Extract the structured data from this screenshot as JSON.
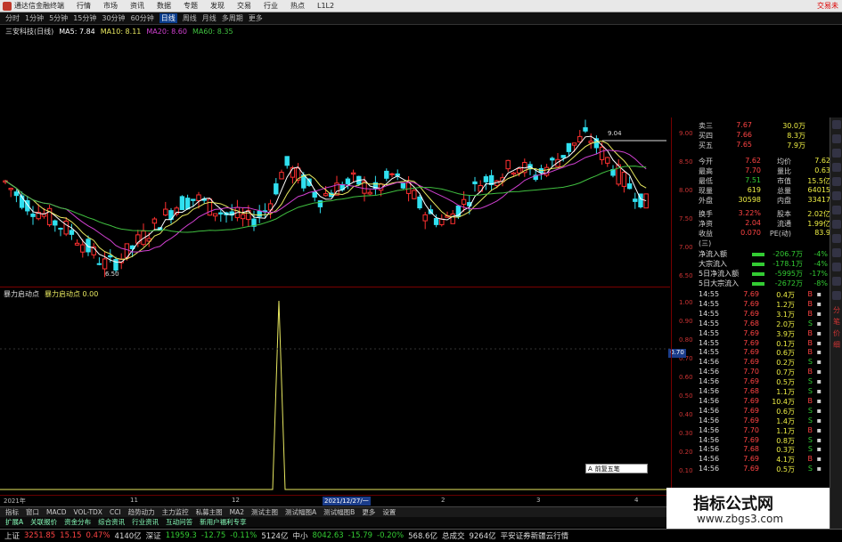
{
  "menubar": {
    "app_title": "通达信金融终端",
    "items": [
      "行情",
      "市场",
      "资讯",
      "数据",
      "专题",
      "发现",
      "交易",
      "行业",
      "热点",
      "L1L2"
    ],
    "right_label": "交易未"
  },
  "periodbar": {
    "items": [
      "分时",
      "1分钟",
      "5分钟",
      "15分钟",
      "30分钟",
      "60分钟",
      "日线",
      "周线",
      "月线",
      "多周期",
      "更多"
    ],
    "active": "日线"
  },
  "ma_legend": {
    "stock": "三安科技(日线)",
    "ma5": "MA5: 7.84",
    "ma10": "MA10: 8.11",
    "ma20": "MA20: 8.60",
    "ma60": "MA60: 8.35"
  },
  "kline": {
    "price_labels": [
      "9.00",
      "8.50",
      "8.00",
      "7.50",
      "7.00",
      "6.50"
    ],
    "low_mark": "6.50",
    "high_mark": "9.04",
    "colors": {
      "up": "#ff3030",
      "down": "#30e0f0",
      "ma5": "#ffffff",
      "ma10": "#e8e860",
      "ma20": "#d040d0",
      "ma60": "#40c040"
    }
  },
  "indicator": {
    "name": "暴力启动点",
    "legend": "暴力启动点 0.00",
    "y_labels": [
      "1.00",
      "0.90",
      "0.80",
      "0.70",
      "0.60",
      "0.50",
      "0.40",
      "0.30",
      "0.20",
      "0.10"
    ],
    "price_tag": "0.70"
  },
  "dateaxis": {
    "labels": [
      "2021年",
      "11",
      "12",
      "2",
      "3",
      "4"
    ],
    "highlight": "2021/12/27/一"
  },
  "popup": {
    "label": "前复五笔"
  },
  "tabs_row1": [
    "指标",
    "窗口",
    "MACD",
    "VOL-TDX",
    "CCI",
    "趋势动力",
    "主力监控",
    "私募主图",
    "MA2",
    "测试主图",
    "测试幅图A",
    "测试幅图B",
    "更多",
    "设置"
  ],
  "tabs_row2": [
    "扩展A",
    "关联报价",
    "资金分布",
    "综合资讯",
    "行业资讯",
    "互动问答",
    "新用户福利专享"
  ],
  "quote": {
    "asks": [
      {
        "label": "卖三",
        "price": "7.67",
        "vol": "30.0万"
      },
      {
        "label": "买四",
        "price": "7.66",
        "vol": "8.3万"
      },
      {
        "label": "买五",
        "price": "7.65",
        "vol": "7.9万"
      }
    ],
    "fields": [
      {
        "l1": "今开",
        "v1": "7.62",
        "l2": "均价",
        "v2": "7.62"
      },
      {
        "l1": "最高",
        "v1": "7.70",
        "l2": "量比",
        "v2": "0.63"
      },
      {
        "l1": "最低",
        "v1": "7.51",
        "l2": "市值",
        "v2": "15.5亿"
      },
      {
        "l1": "现量",
        "v1": "619",
        "l2": "总量",
        "v2": "64015"
      },
      {
        "l1": "外盘",
        "v1": "30598",
        "l2": "内盘",
        "v2": "33417"
      },
      {
        "l1": "换手",
        "v1": "3.22%",
        "l2": "股本",
        "v2": "2.02亿"
      },
      {
        "l1": "净资",
        "v1": "2.04",
        "l2": "流通",
        "v2": "1.99亿"
      },
      {
        "l1": "收益(三)",
        "v1": "0.070",
        "l2": "PE(动)",
        "v2": "83.9"
      }
    ],
    "flows": [
      {
        "label": "净流入额",
        "value": "-206.7万",
        "pct": "-4%"
      },
      {
        "label": "大宗流入",
        "value": "-178.1万",
        "pct": "-4%"
      },
      {
        "label": "5日净流入额",
        "value": "-5995万",
        "pct": "-17%"
      },
      {
        "label": "5日大宗流入",
        "value": "-2672万",
        "pct": "-8%"
      }
    ],
    "ticks": [
      {
        "t": "14:55",
        "p": "7.69",
        "v": "0.4万",
        "s": "B"
      },
      {
        "t": "14:55",
        "p": "7.69",
        "v": "1.2万",
        "s": "B"
      },
      {
        "t": "14:55",
        "p": "7.69",
        "v": "3.1万",
        "s": "B"
      },
      {
        "t": "14:55",
        "p": "7.68",
        "v": "2.0万",
        "s": "S"
      },
      {
        "t": "14:55",
        "p": "7.69",
        "v": "3.9万",
        "s": "B"
      },
      {
        "t": "14:55",
        "p": "7.69",
        "v": "0.1万",
        "s": "B"
      },
      {
        "t": "14:55",
        "p": "7.69",
        "v": "0.6万",
        "s": "B"
      },
      {
        "t": "14:56",
        "p": "7.69",
        "v": "0.2万",
        "s": "S"
      },
      {
        "t": "14:56",
        "p": "7.70",
        "v": "0.7万",
        "s": "B"
      },
      {
        "t": "14:56",
        "p": "7.69",
        "v": "0.5万",
        "s": "S"
      },
      {
        "t": "14:56",
        "p": "7.68",
        "v": "1.1万",
        "s": "S"
      },
      {
        "t": "14:56",
        "p": "7.69",
        "v": "10.4万",
        "s": "B"
      },
      {
        "t": "14:56",
        "p": "7.69",
        "v": "0.6万",
        "s": "S"
      },
      {
        "t": "14:56",
        "p": "7.69",
        "v": "1.4万",
        "s": "S"
      },
      {
        "t": "14:56",
        "p": "7.70",
        "v": "1.1万",
        "s": "B"
      },
      {
        "t": "14:56",
        "p": "7.69",
        "v": "0.8万",
        "s": "S"
      },
      {
        "t": "14:56",
        "p": "7.68",
        "v": "0.3万",
        "s": "S"
      },
      {
        "t": "14:56",
        "p": "7.69",
        "v": "4.1万",
        "s": "B"
      },
      {
        "t": "14:56",
        "p": "7.69",
        "v": "0.5万",
        "s": "S"
      }
    ]
  },
  "rside": {
    "labels": [
      "分",
      "笔",
      "价",
      "细"
    ]
  },
  "status": {
    "sh_label": "上证",
    "sh_value": "3251.85",
    "sh_change": "15.15",
    "sh_pct": "0.47%",
    "sh_amount": "4140亿",
    "sz_label": "深证",
    "sz_value": "11959.3",
    "sz_change": "-12.75",
    "sz_pct": "-0.11%",
    "sz_amount": "5124亿",
    "zx_label": "中小",
    "zx_value": "8042.63",
    "zx_change": "-15.79",
    "zx_pct": "-0.20%",
    "zx_amount": "568.6亿",
    "total_label": "总成交",
    "total_value": "9264亿",
    "broker": "平安证券新疆云行情"
  },
  "watermark": {
    "title": "指标公式网",
    "url": "www.zbgs3.com"
  }
}
